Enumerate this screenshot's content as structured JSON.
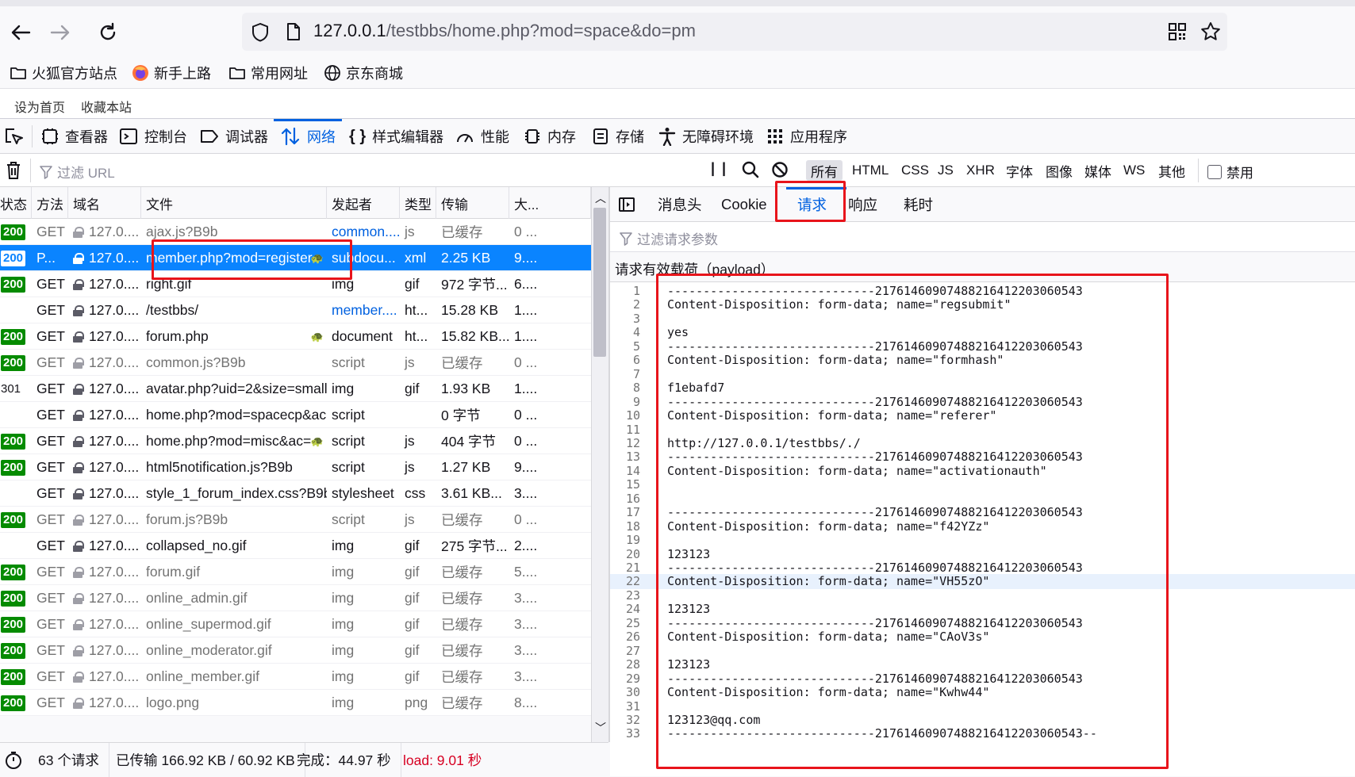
{
  "browser": {
    "url_host": "127.0.0.1",
    "url_path": "/testbbs/home.php?mod=space&do=pm",
    "bookmarks": [
      {
        "label": "火狐官方站点",
        "icon": "folder-icon"
      },
      {
        "label": "新手上路",
        "icon": "firefox-icon"
      },
      {
        "label": "常用网址",
        "icon": "folder-icon"
      },
      {
        "label": "京东商城",
        "icon": "globe-icon"
      }
    ]
  },
  "page": {
    "set_home": "设为首页",
    "bookmark_site": "收藏本站"
  },
  "devtools": {
    "tabs": [
      "查看器",
      "控制台",
      "调试器",
      "网络",
      "样式编辑器",
      "性能",
      "内存",
      "存储",
      "无障碍环境",
      "应用程序"
    ],
    "active_tab": "网络",
    "filter_placeholder": "过滤 URL",
    "type_filters": [
      "所有",
      "HTML",
      "CSS",
      "JS",
      "XHR",
      "字体",
      "图像",
      "媒体",
      "WS",
      "其他"
    ],
    "disable_cache": "禁用",
    "columns": [
      "状态",
      "方法",
      "域名",
      "文件",
      "发起者",
      "类型",
      "传输",
      "大..."
    ],
    "rows": [
      {
        "status": "200",
        "method": "GET",
        "domain": "127.0....",
        "file": "ajax.js?B9b",
        "initiator": "common....",
        "type": "js",
        "transfer": "已缓存",
        "size": "0 ...",
        "cached": true
      },
      {
        "status": "200",
        "method": "P...",
        "domain": "127.0....",
        "file": "member.php?mod=register",
        "initiator": "subdocu...",
        "type": "xml",
        "transfer": "2.25 KB",
        "size": "9....",
        "selected": true
      },
      {
        "status": "200",
        "method": "GET",
        "domain": "127.0....",
        "file": "right.gif",
        "initiator": "img",
        "type": "gif",
        "transfer": "972 字节...",
        "size": "6...."
      },
      {
        "status": "",
        "method": "GET",
        "domain": "127.0....",
        "file": "/testbbs/",
        "initiator": "member....",
        "type": "ht...",
        "transfer": "15.28 KB",
        "size": "1...."
      },
      {
        "status": "200",
        "method": "GET",
        "domain": "127.0....",
        "file": "forum.php",
        "initiator": "document",
        "type": "ht...",
        "transfer": "15.82 KB...",
        "size": "1...."
      },
      {
        "status": "200",
        "method": "GET",
        "domain": "127.0....",
        "file": "common.js?B9b",
        "initiator": "script",
        "type": "js",
        "transfer": "已缓存",
        "size": "0 ...",
        "cached": true
      },
      {
        "status": "301",
        "method": "GET",
        "domain": "127.0....",
        "file": "avatar.php?uid=2&size=small",
        "initiator": "img",
        "type": "gif",
        "transfer": "1.93 KB",
        "size": "1...."
      },
      {
        "status": "",
        "method": "GET",
        "domain": "127.0....",
        "file": "home.php?mod=spacecp&ac=",
        "initiator": "script",
        "type": "",
        "transfer": "0 字节",
        "size": "0 ..."
      },
      {
        "status": "200",
        "method": "GET",
        "domain": "127.0....",
        "file": "home.php?mod=misc&ac=",
        "initiator": "script",
        "type": "js",
        "transfer": "404 字节",
        "size": "0 ..."
      },
      {
        "status": "200",
        "method": "GET",
        "domain": "127.0....",
        "file": "html5notification.js?B9b",
        "initiator": "script",
        "type": "js",
        "transfer": "1.27 KB",
        "size": "9...."
      },
      {
        "status": "",
        "method": "GET",
        "domain": "127.0....",
        "file": "style_1_forum_index.css?B9b",
        "initiator": "stylesheet",
        "type": "css",
        "transfer": "3.61 KB...",
        "size": "3...."
      },
      {
        "status": "200",
        "method": "GET",
        "domain": "127.0....",
        "file": "forum.js?B9b",
        "initiator": "script",
        "type": "js",
        "transfer": "已缓存",
        "size": "0 ...",
        "cached": true
      },
      {
        "status": "",
        "method": "GET",
        "domain": "127.0....",
        "file": "collapsed_no.gif",
        "initiator": "img",
        "type": "gif",
        "transfer": "275 字节...",
        "size": "2...."
      },
      {
        "status": "200",
        "method": "GET",
        "domain": "127.0....",
        "file": "forum.gif",
        "initiator": "img",
        "type": "gif",
        "transfer": "已缓存",
        "size": "5....",
        "cached": true
      },
      {
        "status": "200",
        "method": "GET",
        "domain": "127.0....",
        "file": "online_admin.gif",
        "initiator": "img",
        "type": "gif",
        "transfer": "已缓存",
        "size": "3....",
        "cached": true
      },
      {
        "status": "200",
        "method": "GET",
        "domain": "127.0....",
        "file": "online_supermod.gif",
        "initiator": "img",
        "type": "gif",
        "transfer": "已缓存",
        "size": "3....",
        "cached": true
      },
      {
        "status": "200",
        "method": "GET",
        "domain": "127.0....",
        "file": "online_moderator.gif",
        "initiator": "img",
        "type": "gif",
        "transfer": "已缓存",
        "size": "3....",
        "cached": true
      },
      {
        "status": "200",
        "method": "GET",
        "domain": "127.0....",
        "file": "online_member.gif",
        "initiator": "img",
        "type": "gif",
        "transfer": "已缓存",
        "size": "3....",
        "cached": true
      },
      {
        "status": "200",
        "method": "GET",
        "domain": "127.0....",
        "file": "logo.png",
        "initiator": "img",
        "type": "png",
        "transfer": "已缓存",
        "size": "8....",
        "cached": true
      }
    ],
    "status": {
      "requests": "63 个请求",
      "transferred": "已传输 166.92 KB / 60.92 KB",
      "finish": "完成：44.97 秒",
      "load": "load: 9.01 秒"
    },
    "detail_tabs": [
      "消息头",
      "Cookie",
      "请求",
      "响应",
      "耗时"
    ],
    "active_detail_tab": "请求",
    "param_filter_placeholder": "过滤请求参数",
    "payload_title": "请求有效载荷（payload）",
    "payload_lines": [
      "-----------------------------217614609074882164122030605​43",
      "Content-Disposition: form-data; name=\"regsubmit\"",
      "",
      "yes",
      "-----------------------------21761460907488216412203060543",
      "Content-Disposition: form-data; name=\"formhash\"",
      "",
      "f1ebafd7",
      "-----------------------------21761460907488216412203060543",
      "Content-Disposition: form-data; name=\"referer\"",
      "",
      "http://127.0.0.1/testbbs/./",
      "-----------------------------21761460907488216412203060543",
      "Content-Disposition: form-data; name=\"activationauth\"",
      "",
      "",
      "-----------------------------21761460907488216412203060543",
      "Content-Disposition: form-data; name=\"f42YZz\"",
      "",
      "123123",
      "-----------------------------21761460907488216412203060543",
      "Content-Disposition: form-data; name=\"VH55zO\"",
      "",
      "123123",
      "-----------------------------21761460907488216412203060543",
      "Content-Disposition: form-data; name=\"CAoV3s\"",
      "",
      "123123",
      "-----------------------------21761460907488216412203060543",
      "Content-Disposition: form-data; name=\"Kwhw44\"",
      "",
      "123123@qq.com",
      "-----------------------------21761460907488216412203060543--"
    ],
    "highlighted_line": 22
  },
  "colors": {
    "accent": "#0061e0",
    "selected_row": "#0a84ff",
    "status_ok": "#058b00",
    "annotation": "#e8141b",
    "load_text": "#d70022"
  }
}
